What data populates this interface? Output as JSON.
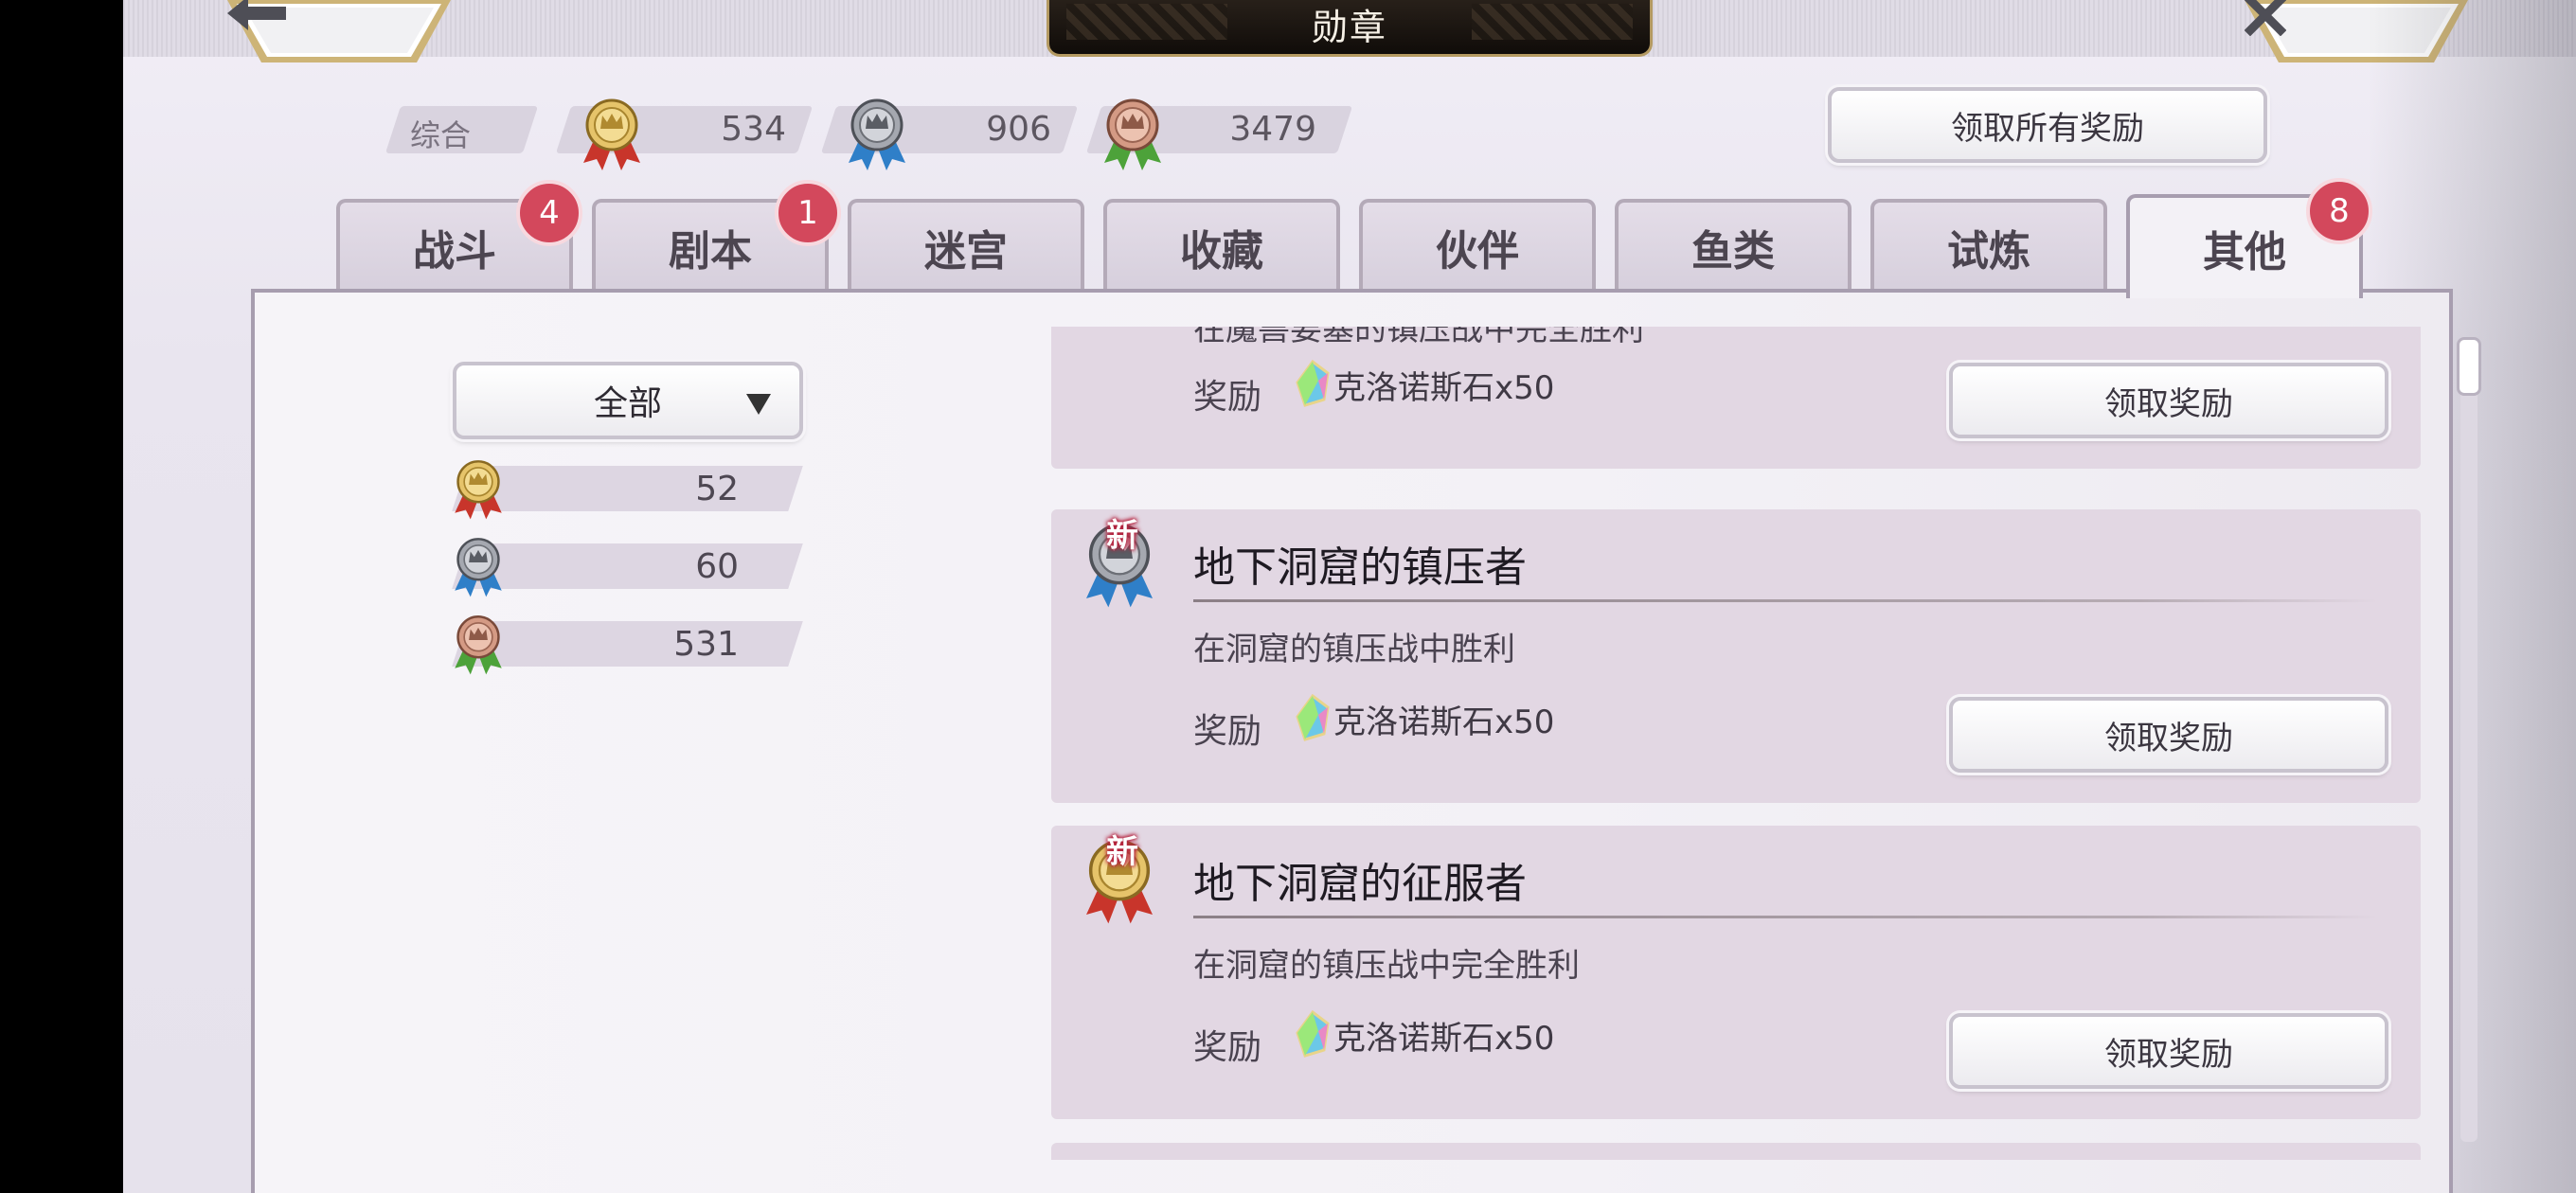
{
  "header": {
    "title": "勋章",
    "back_icon": "arrow-left-icon",
    "close_icon": "close-icon"
  },
  "stats": {
    "label": "综合",
    "gold": "534",
    "silver": "906",
    "bronze": "3479"
  },
  "claim_all_label": "领取所有奖励",
  "tabs": [
    {
      "label": "战斗",
      "badge": "4"
    },
    {
      "label": "剧本",
      "badge": "1"
    },
    {
      "label": "迷宫",
      "badge": ""
    },
    {
      "label": "收藏",
      "badge": ""
    },
    {
      "label": "伙伴",
      "badge": ""
    },
    {
      "label": "鱼类",
      "badge": ""
    },
    {
      "label": "试炼",
      "badge": ""
    },
    {
      "label": "其他",
      "badge": "8"
    }
  ],
  "filter": {
    "selected": "全部"
  },
  "counts": {
    "gold": "52",
    "silver": "60",
    "bronze": "531"
  },
  "cards": [
    {
      "title": "",
      "desc": "在魔兽要塞的镇压战中完全胜利",
      "reward_label": "奖励",
      "reward_item": "克洛诺斯石x50",
      "button": "领取奖励",
      "new": ""
    },
    {
      "title": "地下洞窟的镇压者",
      "desc": "在洞窟的镇压战中胜利",
      "reward_label": "奖励",
      "reward_item": "克洛诺斯石x50",
      "button": "领取奖励",
      "new": "新"
    },
    {
      "title": "地下洞窟的征服者",
      "desc": "在洞窟的镇压战中完全胜利",
      "reward_label": "奖励",
      "reward_item": "克洛诺斯石x50",
      "button": "领取奖励",
      "new": "新"
    }
  ],
  "colors": {
    "gold_ribbon": "#c8352b",
    "silver_ribbon": "#2f7fc8",
    "bronze_ribbon": "#4da23a",
    "badge": "#d3485c"
  }
}
